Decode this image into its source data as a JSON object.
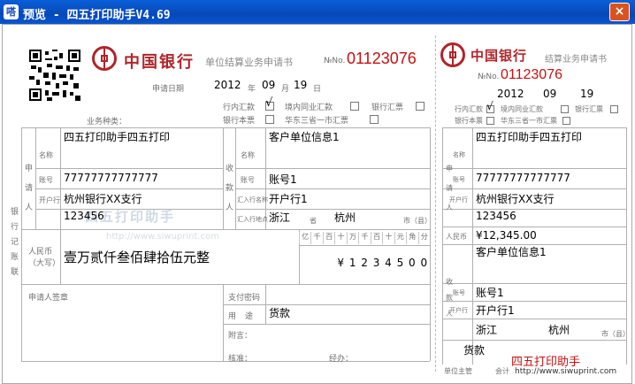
{
  "window": {
    "icon_text": "嗒",
    "title": "预览 - 四五打印助手V4.69",
    "close": "×"
  },
  "bank": {
    "name": "中国银行",
    "form_title": "单位结算业务申请书",
    "form_title_stub": "结算业务申请书",
    "serial_prefix": "№No.",
    "serial": "01123076"
  },
  "date": {
    "label": "申请日期",
    "year": "2012",
    "month": "09",
    "day": "19",
    "y_unit": "年",
    "m_unit": "月",
    "d_unit": "日"
  },
  "business_types": {
    "label": "业务种类：",
    "options": [
      "行内汇款",
      "境内同业汇款",
      "银行汇票",
      "银行本票",
      "华东三省一市汇票"
    ],
    "checked_mark": "√"
  },
  "side_labels": {
    "applicant": "申请人",
    "payee": "收款人",
    "bank_record": "银行记账联",
    "name": "名称",
    "account": "账号",
    "bank": "开户行",
    "remit_bank": "汇入行名称",
    "remit_place": "汇入行地点",
    "province": "省",
    "city": "市（县）",
    "amount_cn": "人民币（大写）",
    "amount_label": "人民币",
    "applicant_seal": "申请人签章",
    "pay_code": "支付密码",
    "purpose": "用途",
    "remark": "附言：",
    "verify": "核准：",
    "reviewer": "经办：",
    "unit_head": "单位主管",
    "accountant": "会计"
  },
  "digits_header": [
    "亿",
    "千",
    "百",
    "十",
    "万",
    "千",
    "百",
    "十",
    "元",
    "角",
    "分"
  ],
  "applicant": {
    "name": "四五打印助手四五打印",
    "account": "77777777777777",
    "bank": "杭州银行XX支行",
    "account_short": "123456"
  },
  "payee": {
    "name": "客户单位信息1",
    "account": "账号1",
    "bank": "开户行1",
    "province": "浙江",
    "city": "杭州"
  },
  "amount": {
    "chinese": "壹万贰仟叁佰肆拾伍元整",
    "digits": [
      "¥",
      "1",
      "2",
      "3",
      "4",
      "5",
      "0",
      "0"
    ],
    "stub": "¥12,345.00"
  },
  "purpose": "货款",
  "watermark": {
    "cn": "四五打印助手",
    "url": "http://www.siwuprint.com",
    "stamp_cn": "四五打印助手",
    "stamp_url": "http://www.siwuprint.com"
  },
  "colors": {
    "titlebar": "#0648b8",
    "serial_red": "#c81010",
    "brand_red": "#b0252a"
  }
}
